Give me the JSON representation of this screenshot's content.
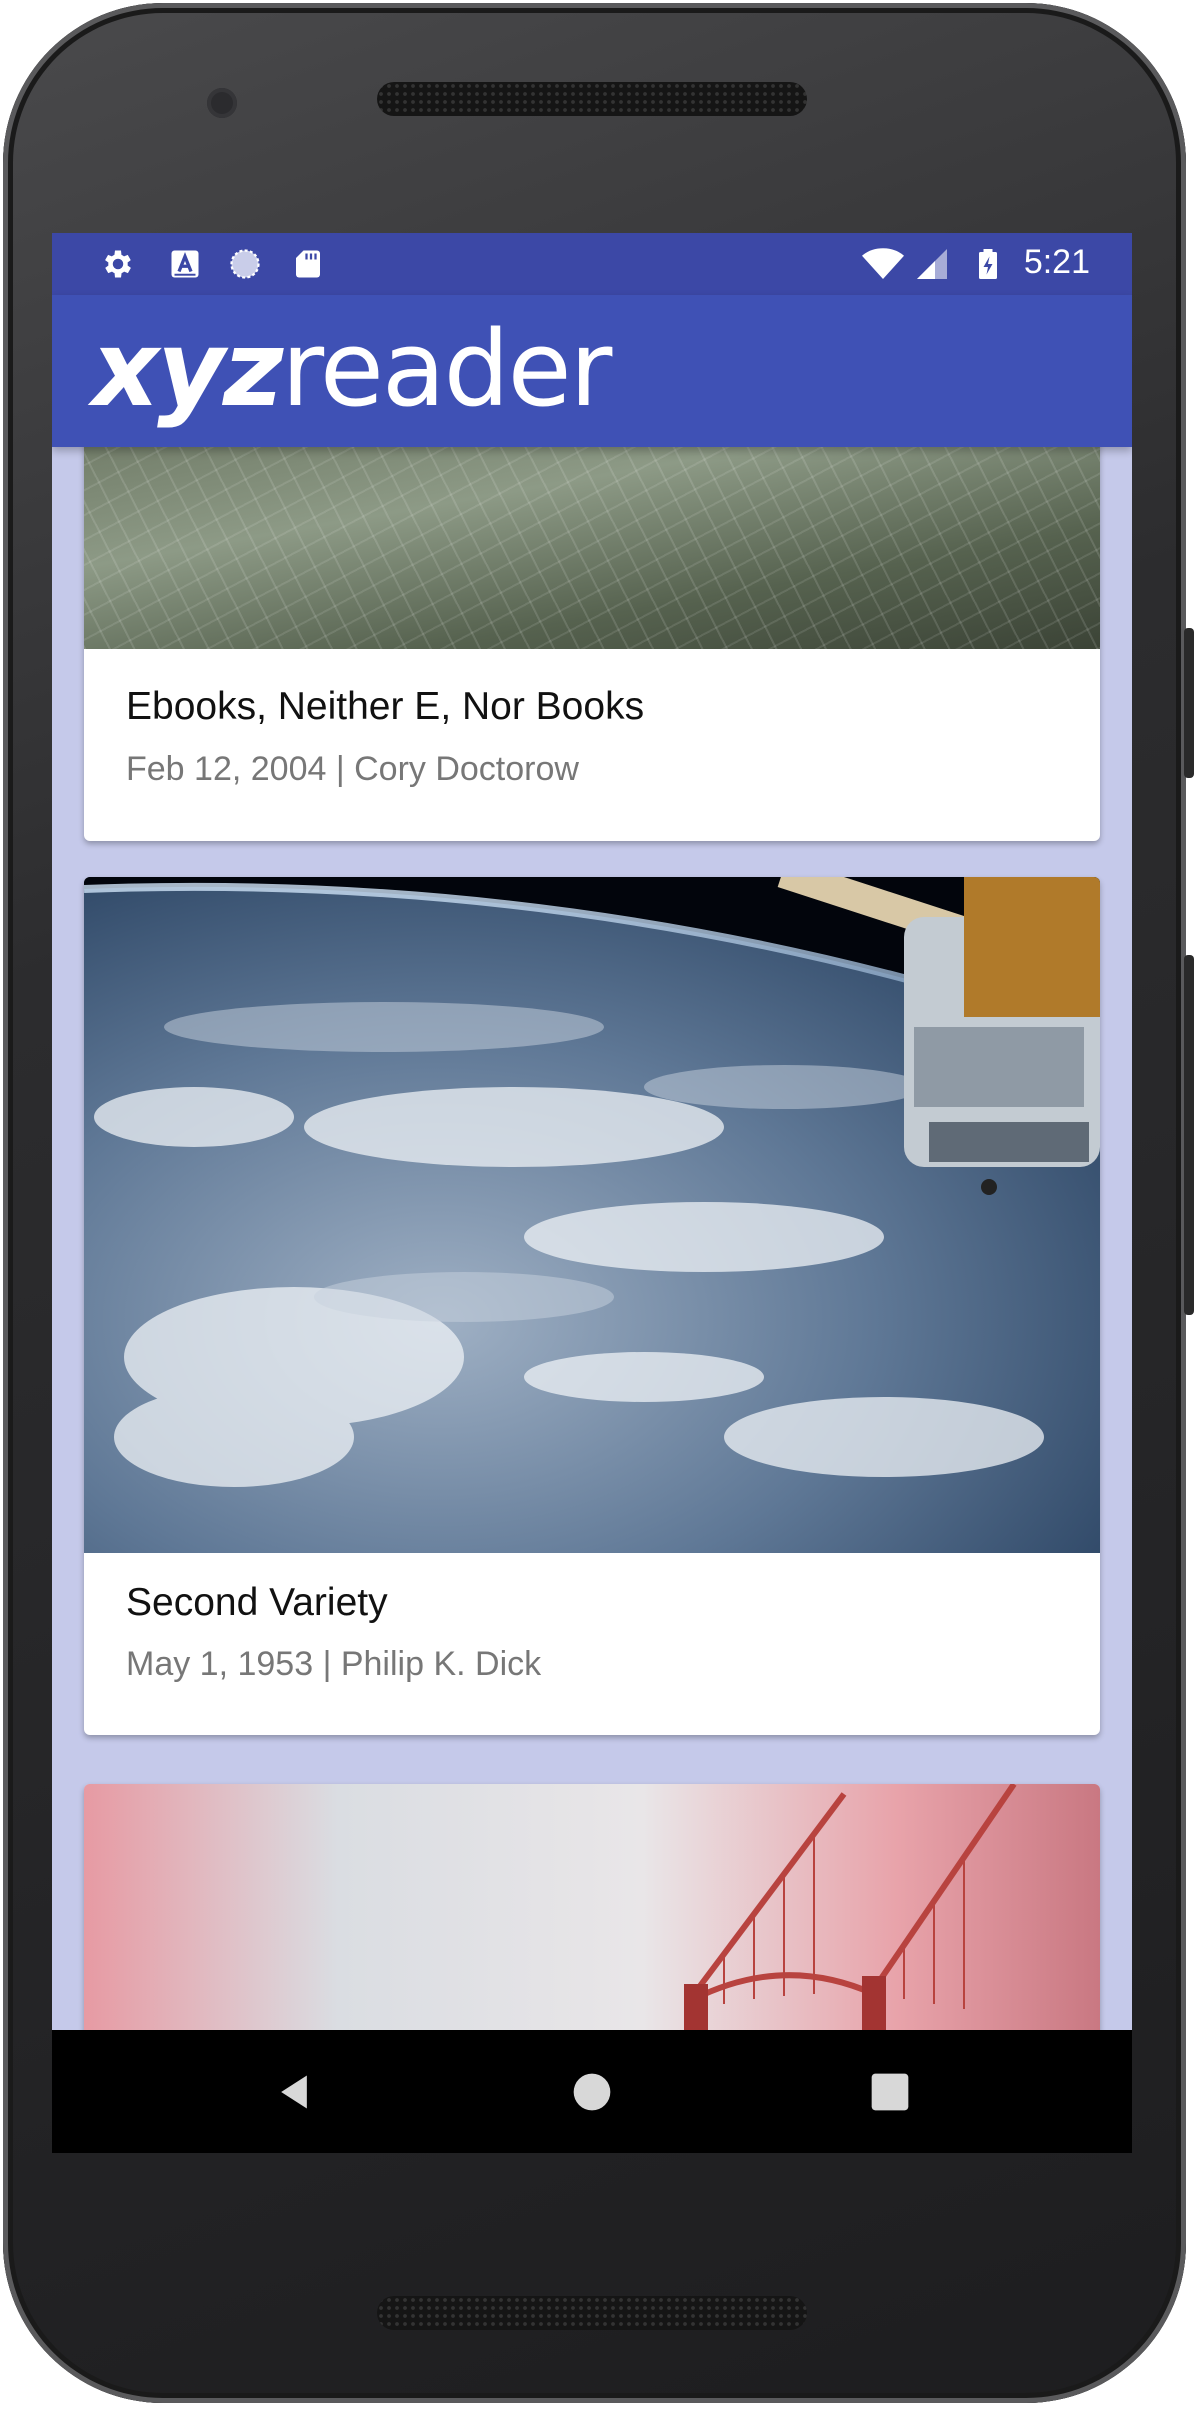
{
  "status_bar": {
    "time": "5:21",
    "left_icons": [
      "settings-icon",
      "text-a-icon",
      "sync-circle-icon",
      "sd-card-icon"
    ],
    "right_icons": [
      "wifi-icon",
      "cell-signal-icon",
      "battery-charging-icon"
    ]
  },
  "app_bar": {
    "logo_bold": "xyz",
    "logo_light": "reader"
  },
  "articles": [
    {
      "title": "Ebooks, Neither E, Nor Books",
      "meta": "Feb 12, 2004 | Cory Doctorow",
      "thumbnail": "architectural-grid-image"
    },
    {
      "title": "Second Variety",
      "meta": "May 1, 1953 | Philip K. Dick",
      "thumbnail": "earth-from-space-image"
    },
    {
      "title": "",
      "meta": "",
      "thumbnail": "bridge-in-fog-image"
    }
  ],
  "nav_bar": {
    "buttons": [
      "back-icon",
      "home-icon",
      "recents-icon"
    ]
  },
  "colors": {
    "primary": "#3f51b5",
    "primary_dark": "#3c48a6",
    "list_background": "#c5c9ea",
    "card_background": "#ffffff"
  }
}
